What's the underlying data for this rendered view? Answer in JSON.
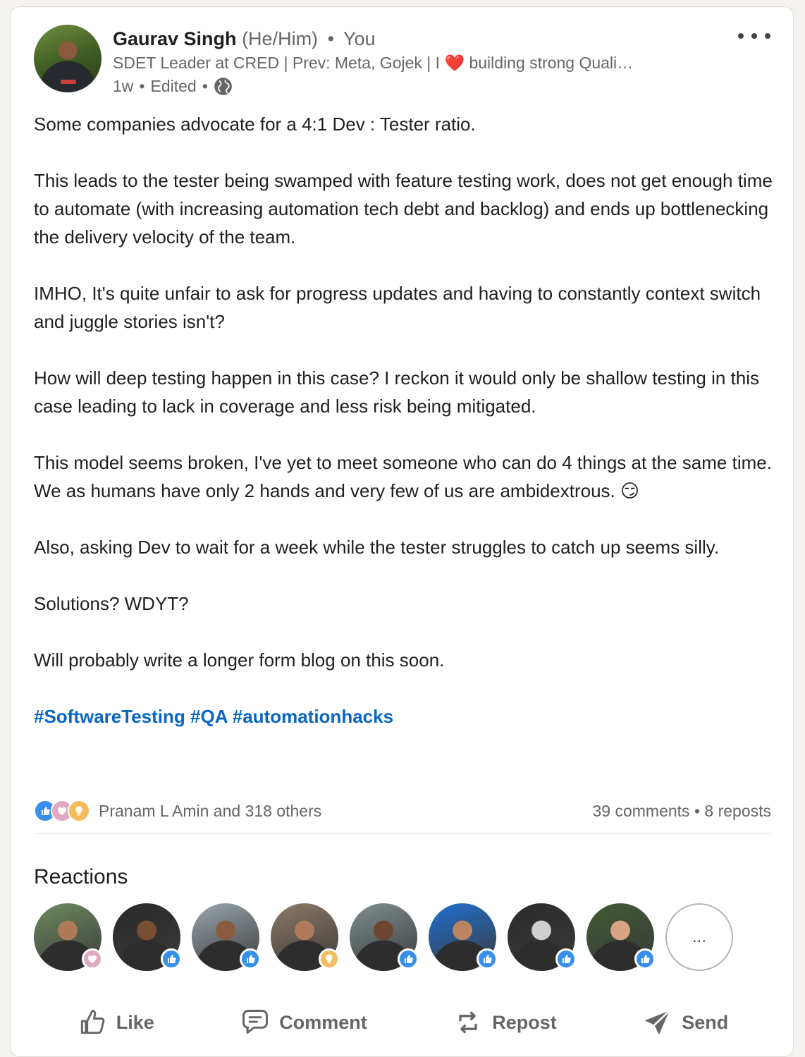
{
  "author": {
    "name": "Gaurav Singh",
    "pronouns": "(He/Him)",
    "relation": "You",
    "headline_before": "SDET Leader at CRED | Prev: Meta, Gojek | I",
    "headline_after": "building strong Quali…",
    "age": "1w",
    "edited": "Edited",
    "separator": "•"
  },
  "post": {
    "paragraphs": [
      "Some companies advocate for a 4:1 Dev : Tester ratio.",
      "This leads to the tester being swamped with feature testing work, does not get enough time to automate (with increasing automation tech debt and backlog) and ends up bottlenecking the delivery velocity of the team.",
      "IMHO, It's quite unfair to ask for progress updates and having to constantly context switch and juggle stories isn't?",
      "How will deep testing happen in this case? I reckon it would only be shallow testing in this case leading to lack in coverage and less risk being mitigated.",
      "This model seems broken, I've yet to meet someone who can do 4 things at the same time. We as humans have only 2 hands and very few of us are ambidextrous. 😏",
      "Also, asking Dev to wait for a week while the tester struggles to catch up seems silly.",
      "Solutions? WDYT?",
      "Will probably write a longer form blog on this soon."
    ],
    "hashtags": [
      "#SoftwareTesting",
      "#QA",
      "#automationhacks"
    ]
  },
  "social": {
    "likers": "Pranam L Amin and 318 others",
    "comments": "39 comments",
    "reposts": "8 reposts",
    "separator": "•"
  },
  "reactions": {
    "title": "Reactions",
    "more_label": "...",
    "people": [
      {
        "reaction": "love",
        "skin": "#b07a58",
        "bg": "#6d8a5e"
      },
      {
        "reaction": "like",
        "skin": "#7a4e33",
        "bg": "#2a2a2a"
      },
      {
        "reaction": "like",
        "skin": "#8a5b3f",
        "bg": "#9aa6ad"
      },
      {
        "reaction": "insight",
        "skin": "#b07b5c",
        "bg": "#8c7a66"
      },
      {
        "reaction": "like",
        "skin": "#6d4630",
        "bg": "#7f8f8f"
      },
      {
        "reaction": "like",
        "skin": "#b98462",
        "bg": "#1f6fd1"
      },
      {
        "reaction": "like",
        "skin": "#cfcfcf",
        "bg": "#2b2b2b"
      },
      {
        "reaction": "like",
        "skin": "#d9a384",
        "bg": "#3f5a32"
      }
    ]
  },
  "actions": {
    "like": "Like",
    "comment": "Comment",
    "repost": "Repost",
    "send": "Send"
  },
  "colors": {
    "accent": "#0a66c2",
    "like": "#378fe9",
    "love": "#dfa9c1",
    "insight": "#f5bb5c"
  }
}
